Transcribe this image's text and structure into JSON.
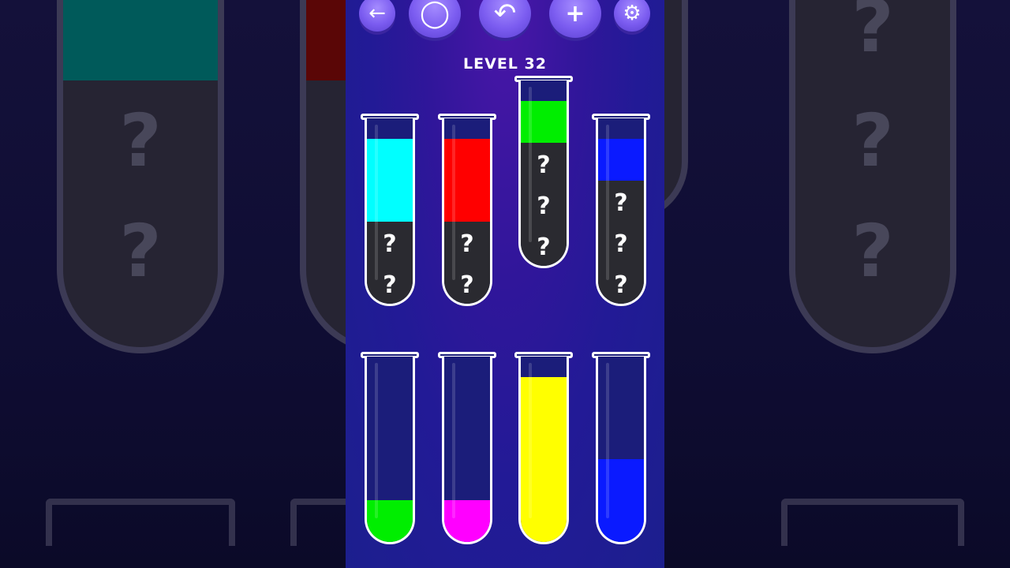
{
  "level": {
    "label": "LEVEL 32"
  },
  "toolbar": {
    "buttons": [
      {
        "name": "back-button",
        "icon": "arrow-left-icon",
        "glyph": "←"
      },
      {
        "name": "restart-button",
        "icon": "restart-icon",
        "glyph": "◯"
      },
      {
        "name": "undo-button",
        "icon": "undo-icon",
        "glyph": "↶"
      },
      {
        "name": "add-tube-button",
        "icon": "add-tube-icon",
        "glyph": "+"
      },
      {
        "name": "settings-button",
        "icon": "gear-icon",
        "glyph": "⚙"
      }
    ]
  },
  "hidden_mark": "?",
  "colors": {
    "cyan": "#00ffff",
    "red": "#ff0000",
    "green": "#00ee00",
    "blue": "#0a1aff",
    "magenta": "#ff00ff",
    "yellow": "#ffff00",
    "hidden": "#2a2a30",
    "empty": "#1b1d7a"
  },
  "tubes": [
    {
      "id": 1,
      "layers_bottom_to_top": [
        "hidden",
        "hidden",
        "cyan",
        "cyan"
      ],
      "state": "idle"
    },
    {
      "id": 2,
      "layers_bottom_to_top": [
        "hidden",
        "hidden",
        "red",
        "red"
      ],
      "state": "idle"
    },
    {
      "id": 3,
      "layers_bottom_to_top": [
        "hidden",
        "hidden",
        "hidden",
        "green"
      ],
      "state": "selected"
    },
    {
      "id": 4,
      "layers_bottom_to_top": [
        "hidden",
        "hidden",
        "hidden",
        "blue"
      ],
      "state": "idle"
    },
    {
      "id": 5,
      "layers_bottom_to_top": [
        "green"
      ],
      "state": "idle"
    },
    {
      "id": 6,
      "layers_bottom_to_top": [
        "magenta"
      ],
      "state": "idle"
    },
    {
      "id": 7,
      "layers_bottom_to_top": [
        "yellow",
        "yellow",
        "yellow",
        "yellow"
      ],
      "state": "idle"
    },
    {
      "id": 8,
      "layers_bottom_to_top": [
        "blue",
        "blue"
      ],
      "state": "idle"
    }
  ]
}
